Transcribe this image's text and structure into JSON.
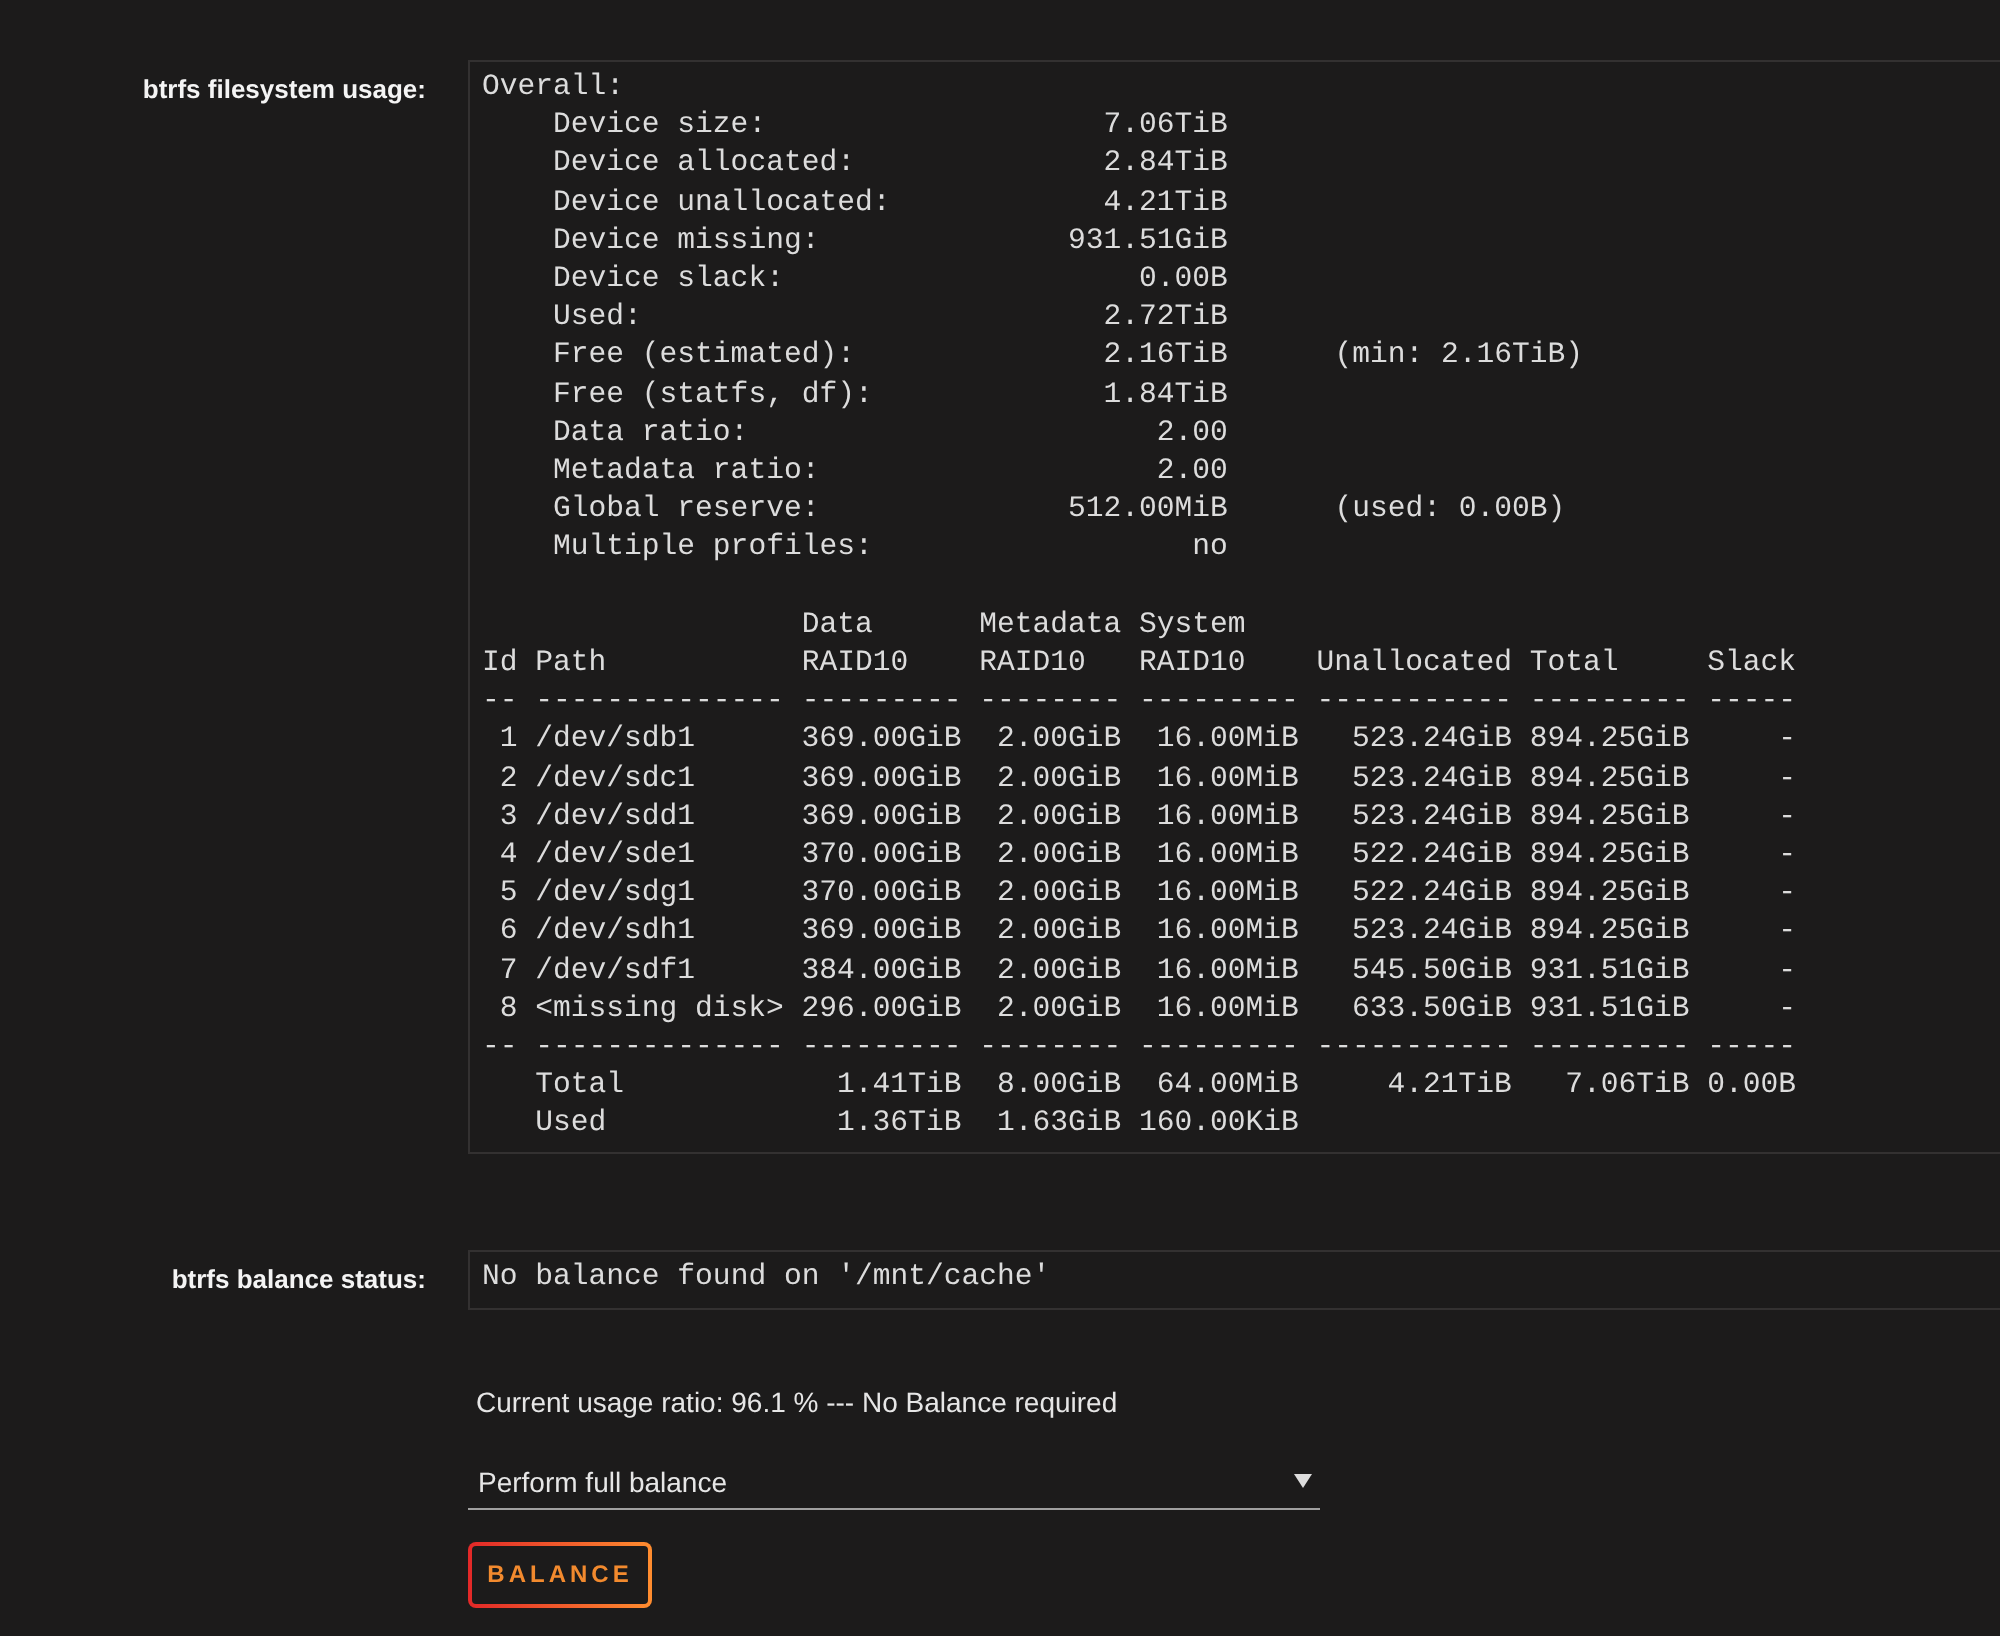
{
  "filesystem_usage": {
    "label": "btrfs filesystem usage:",
    "overall": {
      "title": "Overall:",
      "items": [
        {
          "label": "Device size:",
          "value": "7.06TiB"
        },
        {
          "label": "Device allocated:",
          "value": "2.84TiB"
        },
        {
          "label": "Device unallocated:",
          "value": "4.21TiB"
        },
        {
          "label": "Device missing:",
          "value": "931.51GiB"
        },
        {
          "label": "Device slack:",
          "value": "0.00B"
        },
        {
          "label": "Used:",
          "value": "2.72TiB"
        },
        {
          "label": "Free (estimated):",
          "value": "2.16TiB",
          "note": "(min: 2.16TiB)"
        },
        {
          "label": "Free (statfs, df):",
          "value": "1.84TiB"
        },
        {
          "label": "Data ratio:",
          "value": "2.00"
        },
        {
          "label": "Metadata ratio:",
          "value": "2.00"
        },
        {
          "label": "Global reserve:",
          "value": "512.00MiB",
          "note": "(used: 0.00B)"
        },
        {
          "label": "Multiple profiles:",
          "value": "no"
        }
      ]
    },
    "table": {
      "columns": [
        {
          "name": "Id"
        },
        {
          "name": "Path"
        },
        {
          "name": "Data",
          "profile": "RAID10"
        },
        {
          "name": "Metadata",
          "profile": "RAID10"
        },
        {
          "name": "System",
          "profile": "RAID10"
        },
        {
          "name": "Unallocated"
        },
        {
          "name": "Total"
        },
        {
          "name": "Slack"
        }
      ],
      "header_rule": [
        "--",
        "--------------",
        "---------",
        "--------",
        "---------",
        "-----------",
        "---------",
        "-----"
      ],
      "rows": [
        {
          "cells": [
            "1",
            "/dev/sdb1",
            "369.00GiB",
            "2.00GiB",
            "16.00MiB",
            "523.24GiB",
            "894.25GiB",
            "-"
          ]
        },
        {
          "cells": [
            "2",
            "/dev/sdc1",
            "369.00GiB",
            "2.00GiB",
            "16.00MiB",
            "523.24GiB",
            "894.25GiB",
            "-"
          ]
        },
        {
          "cells": [
            "3",
            "/dev/sdd1",
            "369.00GiB",
            "2.00GiB",
            "16.00MiB",
            "523.24GiB",
            "894.25GiB",
            "-"
          ]
        },
        {
          "cells": [
            "4",
            "/dev/sde1",
            "370.00GiB",
            "2.00GiB",
            "16.00MiB",
            "522.24GiB",
            "894.25GiB",
            "-"
          ]
        },
        {
          "cells": [
            "5",
            "/dev/sdg1",
            "370.00GiB",
            "2.00GiB",
            "16.00MiB",
            "522.24GiB",
            "894.25GiB",
            "-"
          ]
        },
        {
          "cells": [
            "6",
            "/dev/sdh1",
            "369.00GiB",
            "2.00GiB",
            "16.00MiB",
            "523.24GiB",
            "894.25GiB",
            "-"
          ]
        },
        {
          "cells": [
            "7",
            "/dev/sdf1",
            "384.00GiB",
            "2.00GiB",
            "16.00MiB",
            "545.50GiB",
            "931.51GiB",
            "-"
          ]
        },
        {
          "cells": [
            "8",
            "<missing disk>",
            "296.00GiB",
            "2.00GiB",
            "16.00MiB",
            "633.50GiB",
            "931.51GiB",
            "-"
          ]
        }
      ],
      "footer_rule": [
        "--",
        "--------------",
        "---------",
        "--------",
        "---------",
        "-----------",
        "---------",
        "-----"
      ],
      "summary_rows": [
        {
          "label": "Total",
          "values": [
            "1.41TiB",
            "8.00GiB",
            "64.00MiB",
            "4.21TiB",
            "7.06TiB",
            "0.00B"
          ]
        },
        {
          "label": "Used",
          "values": [
            "1.36TiB",
            "1.63GiB",
            "160.00KiB"
          ]
        }
      ]
    }
  },
  "balance_status": {
    "label": "btrfs balance status:",
    "output": "No balance found on '/mnt/cache'"
  },
  "usage_ratio": "Current usage ratio: 96.1 % --- No Balance required",
  "balance_mode": {
    "value": "Perform full balance"
  },
  "balance_button": {
    "label": "BALANCE"
  }
}
